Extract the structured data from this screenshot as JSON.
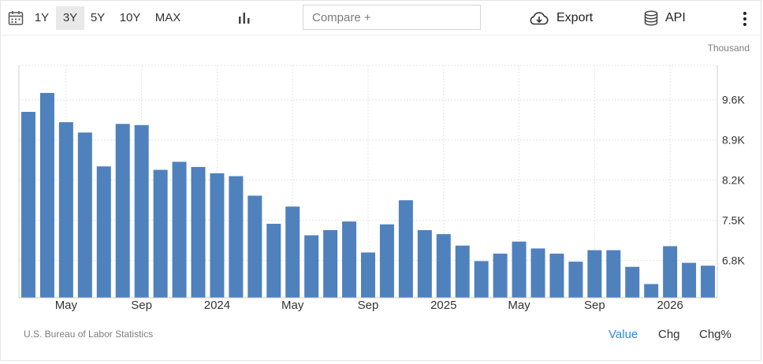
{
  "toolbar": {
    "ranges": [
      "1Y",
      "3Y",
      "5Y",
      "10Y",
      "MAX"
    ],
    "active_range": "3Y",
    "compare_placeholder": "Compare +",
    "export_label": "Export",
    "api_label": "API",
    "icons": [
      "calendar-icon",
      "chart-type-icon",
      "cloud-download-icon",
      "database-icon",
      "more-vert-icon"
    ]
  },
  "footer": {
    "source": "U.S. Bureau of Labor Statistics",
    "modes": [
      "Value",
      "Chg",
      "Chg%"
    ],
    "active_mode": "Value"
  },
  "colors": {
    "bar": "#4f81bd",
    "accent": "#2b8be0",
    "grid": "#e4e4e4"
  },
  "chart_data": {
    "type": "bar",
    "unit_label": "Thousand",
    "x_tick_labels": [
      "May",
      "Sep",
      "2024",
      "May",
      "Sep",
      "2025",
      "May",
      "Sep",
      "2026"
    ],
    "x_tick_months": [
      "2023-05",
      "2023-09",
      "2024-01",
      "2024-05",
      "2024-09",
      "2025-01",
      "2025-05",
      "2025-09",
      "2026-01"
    ],
    "y_ticks": [
      6.8,
      7.5,
      8.2,
      8.9,
      9.6
    ],
    "y_tick_labels": [
      "6.8K",
      "7.5K",
      "8.2K",
      "8.9K",
      "9.6K"
    ],
    "ylim": [
      6.15,
      10.2
    ],
    "grid": true,
    "categories": [
      "2023-03",
      "2023-04",
      "2023-05",
      "2023-06",
      "2023-07",
      "2023-08",
      "2023-09",
      "2023-10",
      "2023-11",
      "2023-12",
      "2024-01",
      "2024-02",
      "2024-03",
      "2024-04",
      "2024-05",
      "2024-06",
      "2024-07",
      "2024-08",
      "2024-09",
      "2024-10",
      "2024-11",
      "2024-12",
      "2025-01",
      "2025-02",
      "2025-03",
      "2025-04",
      "2025-05",
      "2025-06",
      "2025-07",
      "2025-08",
      "2025-09",
      "2025-10",
      "2025-11",
      "2025-12",
      "2026-01",
      "2026-02",
      "2026-03"
    ],
    "values": [
      9.39,
      9.72,
      9.21,
      9.03,
      8.44,
      9.18,
      9.16,
      8.38,
      8.52,
      8.43,
      8.32,
      8.27,
      7.93,
      7.44,
      7.74,
      7.24,
      7.33,
      7.48,
      6.94,
      7.43,
      7.85,
      7.33,
      7.26,
      7.06,
      6.79,
      6.92,
      7.13,
      7.01,
      6.92,
      6.78,
      6.98,
      6.98,
      6.69,
      6.39,
      7.05,
      6.76,
      6.71
    ]
  }
}
